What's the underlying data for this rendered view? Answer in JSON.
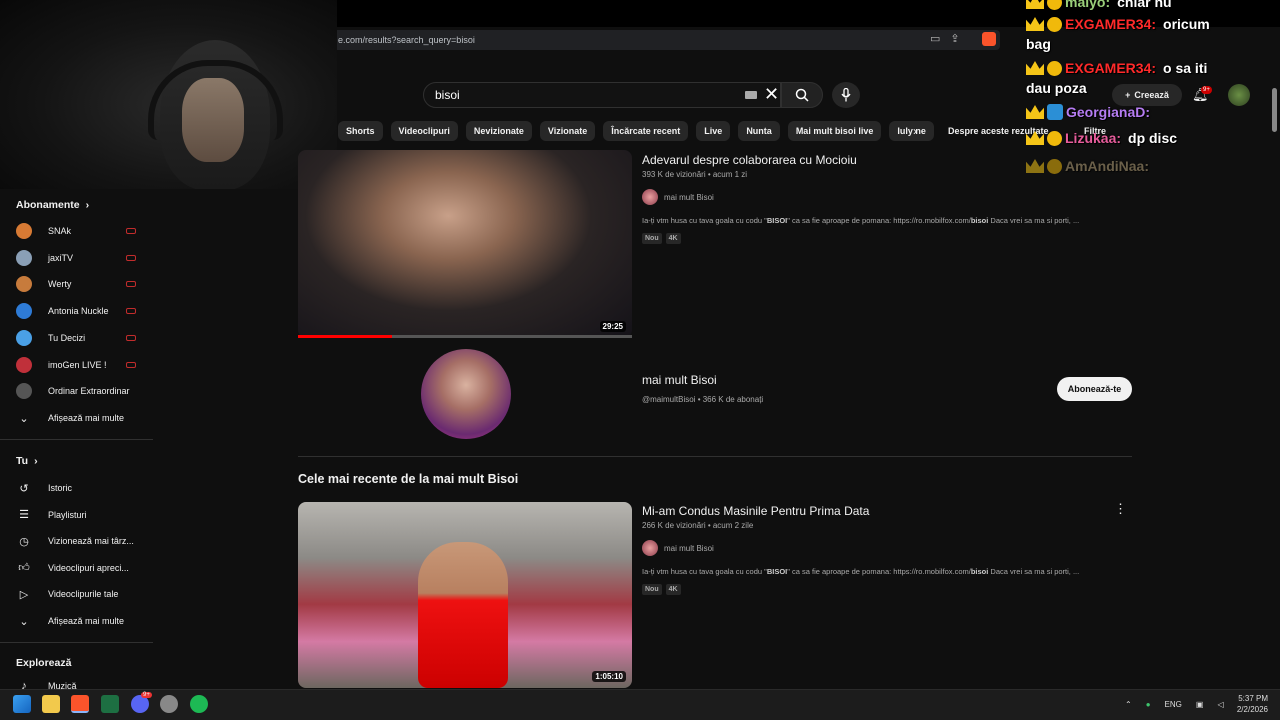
{
  "browser": {
    "url_visible": "e.com/results?search_query=bisoi"
  },
  "search": {
    "query": "bisoi"
  },
  "header": {
    "create_label": "Creează",
    "notifications_badge": "9+"
  },
  "chips": [
    "Shorts",
    "Videoclipuri",
    "Nevizionate",
    "Vizionate",
    "Încărcate recent",
    "Live",
    "Nunta",
    "Mai mult bisoi live",
    "Iuly ne"
  ],
  "about_results": "Despre aceste rezultate",
  "filters_label": "Filtre",
  "sidebar": {
    "subscriptions_title": "Abonamente",
    "subscriptions": [
      {
        "label": "SNAk",
        "color": "#d77a34"
      },
      {
        "label": "jaxiTV",
        "color": "#8a9fb6"
      },
      {
        "label": "Werty",
        "color": "#c77b3c"
      },
      {
        "label": "Antonia Nuckle",
        "color": "#2e7bd6"
      },
      {
        "label": "Tu Decizi",
        "color": "#4aa0e6"
      },
      {
        "label": "imoGen LIVE !",
        "color": "#c0303a"
      },
      {
        "label": "Ordinar Extraordinar",
        "color": "#555555"
      }
    ],
    "show_more_1": "Afișează mai multe",
    "you_title": "Tu",
    "you_items": [
      {
        "label": "Istoric",
        "icon": "history-icon"
      },
      {
        "label": "Playlisturi",
        "icon": "playlist-icon"
      },
      {
        "label": "Vizionează mai târz...",
        "icon": "watch-later-icon"
      },
      {
        "label": "Videoclipuri apreci...",
        "icon": "thumbs-up-icon"
      },
      {
        "label": "Videoclipurile tale",
        "icon": "your-videos-icon"
      }
    ],
    "show_more_2": "Afișează mai multe",
    "explore_title": "Explorează",
    "explore_items": [
      {
        "label": "Muzică"
      }
    ]
  },
  "video1": {
    "title": "Adevarul despre colaborarea cu Mocioiu",
    "meta": "393 K de vizionări • acum 1 zi",
    "channel": "mai mult Bisoi",
    "desc_pre": "Ia-ți vtm husa cu tava goala cu codu \"",
    "desc_bold": "BISOI",
    "desc_mid": "\" ca sa fie aproape de pomana: https://ro.mobilfox.com/",
    "desc_bold2": "bisoi",
    "desc_post": " Daca vrei sa ma si porti, ...",
    "badges": [
      "Nou",
      "4K"
    ],
    "duration": "29:25",
    "progress": 0.28
  },
  "channel": {
    "name": "mai mult Bisoi",
    "meta": "@maimultBisoi • 366 K de abonați",
    "subscribe_label": "Abonează-te"
  },
  "section_title": "Cele mai recente de la mai mult Bisoi",
  "video2": {
    "title": "Mi-am Condus Masinile Pentru Prima Data",
    "meta": "266 K de vizionări • acum 2 zile",
    "channel": "mai mult Bisoi",
    "desc_pre": "Ia-ți vtm husa cu tava goala cu codu \"",
    "desc_bold": "BISOI",
    "desc_mid": "\" ca sa fie aproape de pomana: https://ro.mobilfox.com/",
    "desc_bold2": "bisoi",
    "desc_post": " Daca vrei sa ma si porti, ...",
    "badges": [
      "Nou",
      "4K"
    ],
    "duration": "1:05:10"
  },
  "chat": [
    {
      "user": "maiyo:",
      "msg": "chiar nu",
      "color": "#9ad07a"
    },
    {
      "user": "EXGAMER34:",
      "msg": "oricum",
      "color": "#ff2a2a"
    },
    {
      "user": "",
      "msg": "bag",
      "color": "#ffffff"
    },
    {
      "user": "EXGAMER34:",
      "msg": "o sa iti",
      "color": "#ff2a2a"
    },
    {
      "user": "",
      "msg": "dau poza",
      "color": "#ffffff"
    },
    {
      "user": "GeorgianaD:",
      "msg": "",
      "color": "#b57cf2"
    },
    {
      "user": "Lizukaa:",
      "msg": "dp disc",
      "color": "#e75d9c"
    },
    {
      "user": "AmAndiNaa:",
      "msg": "",
      "color": "#b6a27a"
    }
  ],
  "taskbar": {
    "lang": "ENG",
    "time": "5:37 PM",
    "date": "2/2/2026",
    "discord_badge": "9+"
  }
}
